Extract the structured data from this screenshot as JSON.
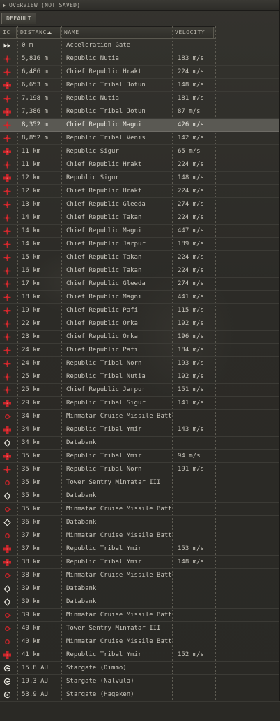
{
  "window": {
    "title": "OVERVIEW (NOT SAVED)",
    "tab": "DEFAULT"
  },
  "columns": {
    "icon": "IC",
    "distance": "DISTANC",
    "name": "NAME",
    "velocity": "VELOCITY"
  },
  "colors": {
    "hostile_red": "#c8252a",
    "neutral_white": "#e8e6de"
  },
  "rows": [
    {
      "icon": "gate-arrows-icon",
      "dist": "0 m",
      "name": "Acceleration Gate",
      "vel": ""
    },
    {
      "icon": "frigate-cross-icon",
      "dist": "5,816 m",
      "name": "Republic Nutia",
      "vel": "183 m/s"
    },
    {
      "icon": "frigate-cross-icon",
      "dist": "6,486 m",
      "name": "Chief Republic Hrakt",
      "vel": "224 m/s"
    },
    {
      "icon": "battleship-cross-icon",
      "dist": "6,653 m",
      "name": "Republic Tribal Jotun",
      "vel": "148 m/s"
    },
    {
      "icon": "frigate-cross-icon",
      "dist": "7,198 m",
      "name": "Republic Nutia",
      "vel": "181 m/s"
    },
    {
      "icon": "battleship-cross-icon",
      "dist": "7,386 m",
      "name": "Republic Tribal Jotun",
      "vel": "87 m/s"
    },
    {
      "icon": "frigate-cross-icon",
      "dist": "8,352 m",
      "name": "Chief Republic Magni",
      "vel": "426 m/s",
      "selected": true
    },
    {
      "icon": "frigate-cross-icon",
      "dist": "8,852 m",
      "name": "Republic Tribal Venis",
      "vel": "142 m/s"
    },
    {
      "icon": "battleship-cross-icon",
      "dist": "11 km",
      "name": "Republic Sigur",
      "vel": "65 m/s"
    },
    {
      "icon": "frigate-cross-icon",
      "dist": "11 km",
      "name": "Chief Republic Hrakt",
      "vel": "224 m/s"
    },
    {
      "icon": "battleship-cross-icon",
      "dist": "12 km",
      "name": "Republic Sigur",
      "vel": "148 m/s"
    },
    {
      "icon": "frigate-cross-icon",
      "dist": "12 km",
      "name": "Chief Republic Hrakt",
      "vel": "224 m/s"
    },
    {
      "icon": "frigate-cross-icon",
      "dist": "13 km",
      "name": "Chief Republic Gleeda",
      "vel": "274 m/s"
    },
    {
      "icon": "frigate-cross-icon",
      "dist": "14 km",
      "name": "Chief Republic Takan",
      "vel": "224 m/s"
    },
    {
      "icon": "frigate-cross-icon",
      "dist": "14 km",
      "name": "Chief Republic Magni",
      "vel": "447 m/s"
    },
    {
      "icon": "frigate-cross-icon",
      "dist": "14 km",
      "name": "Chief Republic Jarpur",
      "vel": "189 m/s"
    },
    {
      "icon": "frigate-cross-icon",
      "dist": "15 km",
      "name": "Chief Republic Takan",
      "vel": "224 m/s"
    },
    {
      "icon": "frigate-cross-icon",
      "dist": "16 km",
      "name": "Chief Republic Takan",
      "vel": "224 m/s"
    },
    {
      "icon": "frigate-cross-icon",
      "dist": "17 km",
      "name": "Chief Republic Gleeda",
      "vel": "274 m/s"
    },
    {
      "icon": "frigate-cross-icon",
      "dist": "18 km",
      "name": "Chief Republic Magni",
      "vel": "441 m/s"
    },
    {
      "icon": "frigate-cross-icon",
      "dist": "19 km",
      "name": "Chief Republic Pafi",
      "vel": "115 m/s"
    },
    {
      "icon": "frigate-cross-icon",
      "dist": "22 km",
      "name": "Chief Republic Orka",
      "vel": "192 m/s"
    },
    {
      "icon": "frigate-cross-icon",
      "dist": "23 km",
      "name": "Chief Republic Orka",
      "vel": "196 m/s"
    },
    {
      "icon": "frigate-cross-icon",
      "dist": "24 km",
      "name": "Chief Republic Pafi",
      "vel": "184 m/s"
    },
    {
      "icon": "frigate-cross-icon",
      "dist": "24 km",
      "name": "Republic Tribal Norn",
      "vel": "193 m/s"
    },
    {
      "icon": "frigate-cross-icon",
      "dist": "25 km",
      "name": "Republic Tribal Nutia",
      "vel": "192 m/s"
    },
    {
      "icon": "frigate-cross-icon",
      "dist": "25 km",
      "name": "Chief Republic Jarpur",
      "vel": "151 m/s"
    },
    {
      "icon": "battleship-cross-icon",
      "dist": "29 km",
      "name": "Republic Tribal Sigur",
      "vel": "141 m/s"
    },
    {
      "icon": "sentry-circle-icon",
      "dist": "34 km",
      "name": "Minmatar Cruise Missile Battery",
      "vel": ""
    },
    {
      "icon": "battleship-cross-icon",
      "dist": "34 km",
      "name": "Republic Tribal Ymir",
      "vel": "143 m/s"
    },
    {
      "icon": "container-diamond-icon",
      "dist": "34 km",
      "name": "Databank",
      "vel": ""
    },
    {
      "icon": "battleship-cross-icon",
      "dist": "35 km",
      "name": "Republic Tribal Ymir",
      "vel": "94 m/s"
    },
    {
      "icon": "frigate-cross-icon",
      "dist": "35 km",
      "name": "Republic Tribal Norn",
      "vel": "191 m/s"
    },
    {
      "icon": "sentry-circle-icon",
      "dist": "35 km",
      "name": "Tower Sentry Minmatar III",
      "vel": ""
    },
    {
      "icon": "container-diamond-icon",
      "dist": "35 km",
      "name": "Databank",
      "vel": ""
    },
    {
      "icon": "sentry-circle-icon",
      "dist": "35 km",
      "name": "Minmatar Cruise Missile Battery",
      "vel": ""
    },
    {
      "icon": "container-diamond-icon",
      "dist": "36 km",
      "name": "Databank",
      "vel": ""
    },
    {
      "icon": "sentry-circle-icon",
      "dist": "37 km",
      "name": "Minmatar Cruise Missile Battery",
      "vel": ""
    },
    {
      "icon": "battleship-cross-icon",
      "dist": "37 km",
      "name": "Republic Tribal Ymir",
      "vel": "153 m/s"
    },
    {
      "icon": "battleship-cross-icon",
      "dist": "38 km",
      "name": "Republic Tribal Ymir",
      "vel": "148 m/s"
    },
    {
      "icon": "sentry-circle-icon",
      "dist": "38 km",
      "name": "Minmatar Cruise Missile Battery",
      "vel": ""
    },
    {
      "icon": "container-diamond-icon",
      "dist": "39 km",
      "name": "Databank",
      "vel": ""
    },
    {
      "icon": "container-diamond-icon",
      "dist": "39 km",
      "name": "Databank",
      "vel": ""
    },
    {
      "icon": "sentry-circle-icon",
      "dist": "39 km",
      "name": "Minmatar Cruise Missile Battery",
      "vel": ""
    },
    {
      "icon": "sentry-circle-icon",
      "dist": "40 km",
      "name": "Tower Sentry Minmatar III",
      "vel": ""
    },
    {
      "icon": "sentry-circle-icon",
      "dist": "40 km",
      "name": "Minmatar Cruise Missile Battery",
      "vel": ""
    },
    {
      "icon": "battleship-cross-icon",
      "dist": "41 km",
      "name": "Republic Tribal Ymir",
      "vel": "152 m/s"
    },
    {
      "icon": "stargate-icon",
      "dist": "15.8 AU",
      "name": "Stargate (Dimmo)",
      "vel": ""
    },
    {
      "icon": "stargate-icon",
      "dist": "19.3 AU",
      "name": "Stargate (Nalvula)",
      "vel": ""
    },
    {
      "icon": "stargate-icon",
      "dist": "53.9 AU",
      "name": "Stargate (Hageken)",
      "vel": ""
    }
  ]
}
